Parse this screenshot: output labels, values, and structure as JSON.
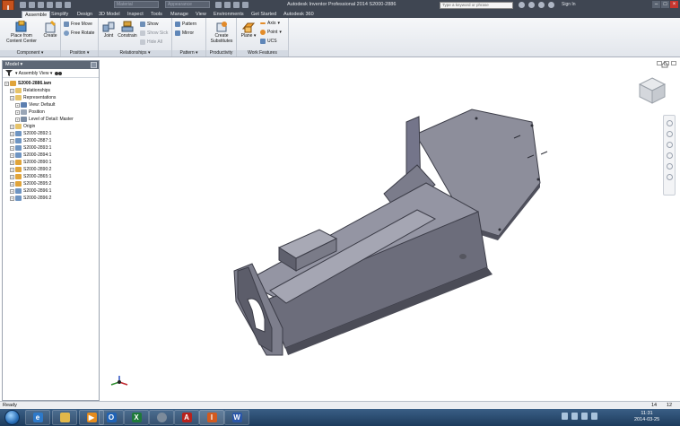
{
  "app": {
    "logo_letter": "I",
    "title": "Autodesk Inventor Professional 2014   S2000-2886",
    "qat_combo_material": "Material",
    "qat_combo_appearance": "Appearance",
    "search_placeholder": "Type a keyword or phrase",
    "sign_in": "Sign In"
  },
  "tabs": [
    "Assemble",
    "Simplify",
    "Design",
    "3D Model",
    "Inspect",
    "Tools",
    "Manage",
    "View",
    "Environments",
    "Get Started",
    "Autodesk 360"
  ],
  "active_tab": "Assemble",
  "ribbon": {
    "component": {
      "label": "Component",
      "place_label_1": "Place from",
      "place_label_2": "Content Center",
      "create_label": "Create"
    },
    "position": {
      "label": "Position",
      "free_move": "Free Move",
      "free_rotate": "Free Rotate"
    },
    "relationships": {
      "label": "Relationships",
      "joint": "Joint",
      "constrain": "Constrain",
      "show": "Show",
      "show_sick": "Show Sick",
      "hide_all": "Hide All"
    },
    "pattern": {
      "label": "Pattern",
      "pattern": "Pattern",
      "mirror": "Mirror"
    },
    "productivity": {
      "label": "Productivity",
      "create_substitutes_1": "Create",
      "create_substitutes_2": "Substitutes"
    },
    "work_features": {
      "label": "Work Features",
      "plane": "Plane",
      "axis": "Axis",
      "point": "Point",
      "ucs": "UCS"
    }
  },
  "browser": {
    "title": "Model",
    "view_selector": "Assembly View",
    "items": [
      {
        "label": "S2000-2886.iam",
        "level": 0,
        "icon": "assembly"
      },
      {
        "label": "Relationships",
        "level": 1,
        "icon": "folder"
      },
      {
        "label": "Representations",
        "level": 1,
        "icon": "folder"
      },
      {
        "label": "View: Default",
        "level": 2,
        "icon": "glasses"
      },
      {
        "label": "Position",
        "level": 2,
        "icon": "position"
      },
      {
        "label": "Level of Detail: Master",
        "level": 2,
        "icon": "lod"
      },
      {
        "label": "Origin",
        "level": 1,
        "icon": "folder"
      },
      {
        "label": "S2000-2892:1",
        "level": 1,
        "icon": "part"
      },
      {
        "label": "S2000-2887:1",
        "level": 1,
        "icon": "part"
      },
      {
        "label": "S2000-2893:1",
        "level": 1,
        "icon": "part"
      },
      {
        "label": "S2000-2894:1",
        "level": 1,
        "icon": "part"
      },
      {
        "label": "S2000-2890:1",
        "level": 1,
        "icon": "subassembly"
      },
      {
        "label": "S2000-2890:2",
        "level": 1,
        "icon": "subassembly"
      },
      {
        "label": "S2000-2865:1",
        "level": 1,
        "icon": "subassembly"
      },
      {
        "label": "S2000-2895:2",
        "level": 1,
        "icon": "subassembly"
      },
      {
        "label": "S2000-2896:1",
        "level": 1,
        "icon": "part"
      },
      {
        "label": "S2000-2896:2",
        "level": 1,
        "icon": "part"
      }
    ]
  },
  "statusbar": {
    "status": "Ready",
    "count_a": "14",
    "count_b": "12"
  },
  "taskbar": {
    "time": "11:31",
    "date": "2014-03-25",
    "apps": [
      "internet-explorer",
      "file-explorer",
      "media-player",
      "outlook",
      "excel",
      "chrome",
      "acrobat",
      "inventor",
      "word"
    ]
  },
  "colors": {
    "title_bar": "#3f4652",
    "ribbon_bg": "#e8ebf0",
    "model_face": "#8a8b98",
    "model_dark": "#4e4f5c",
    "taskbar": "#25486e"
  }
}
